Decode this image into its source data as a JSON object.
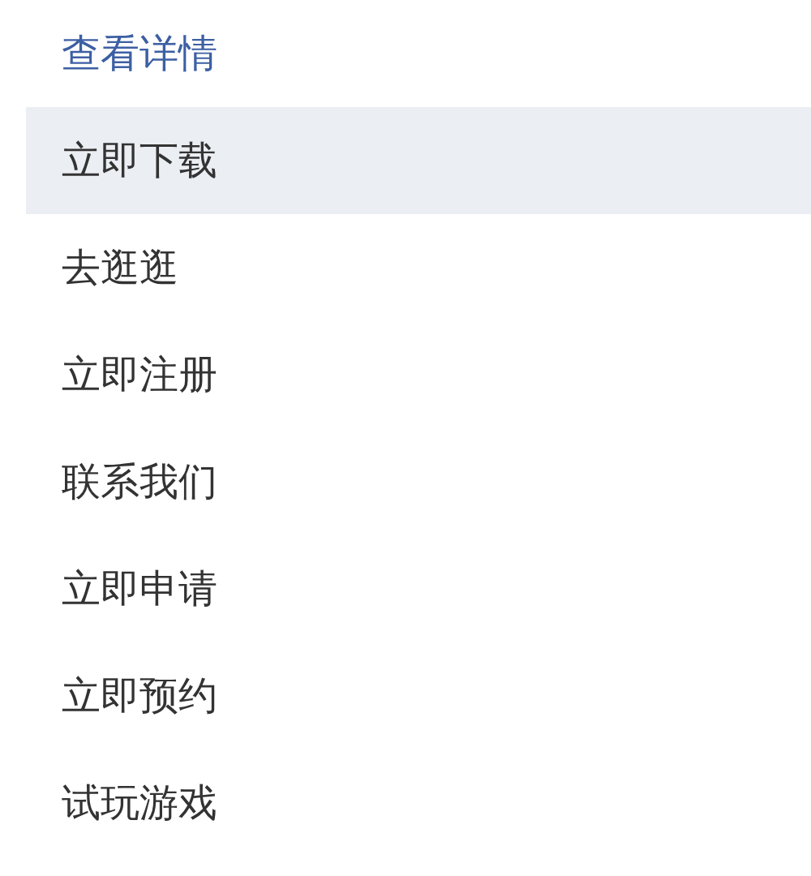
{
  "menu": {
    "items": [
      {
        "label": "查看详情",
        "selected": true,
        "hovered": false
      },
      {
        "label": "立即下载",
        "selected": false,
        "hovered": true
      },
      {
        "label": "去逛逛",
        "selected": false,
        "hovered": false
      },
      {
        "label": "立即注册",
        "selected": false,
        "hovered": false
      },
      {
        "label": "联系我们",
        "selected": false,
        "hovered": false
      },
      {
        "label": "立即申请",
        "selected": false,
        "hovered": false
      },
      {
        "label": "立即预约",
        "selected": false,
        "hovered": false
      },
      {
        "label": "试玩游戏",
        "selected": false,
        "hovered": false
      }
    ]
  }
}
